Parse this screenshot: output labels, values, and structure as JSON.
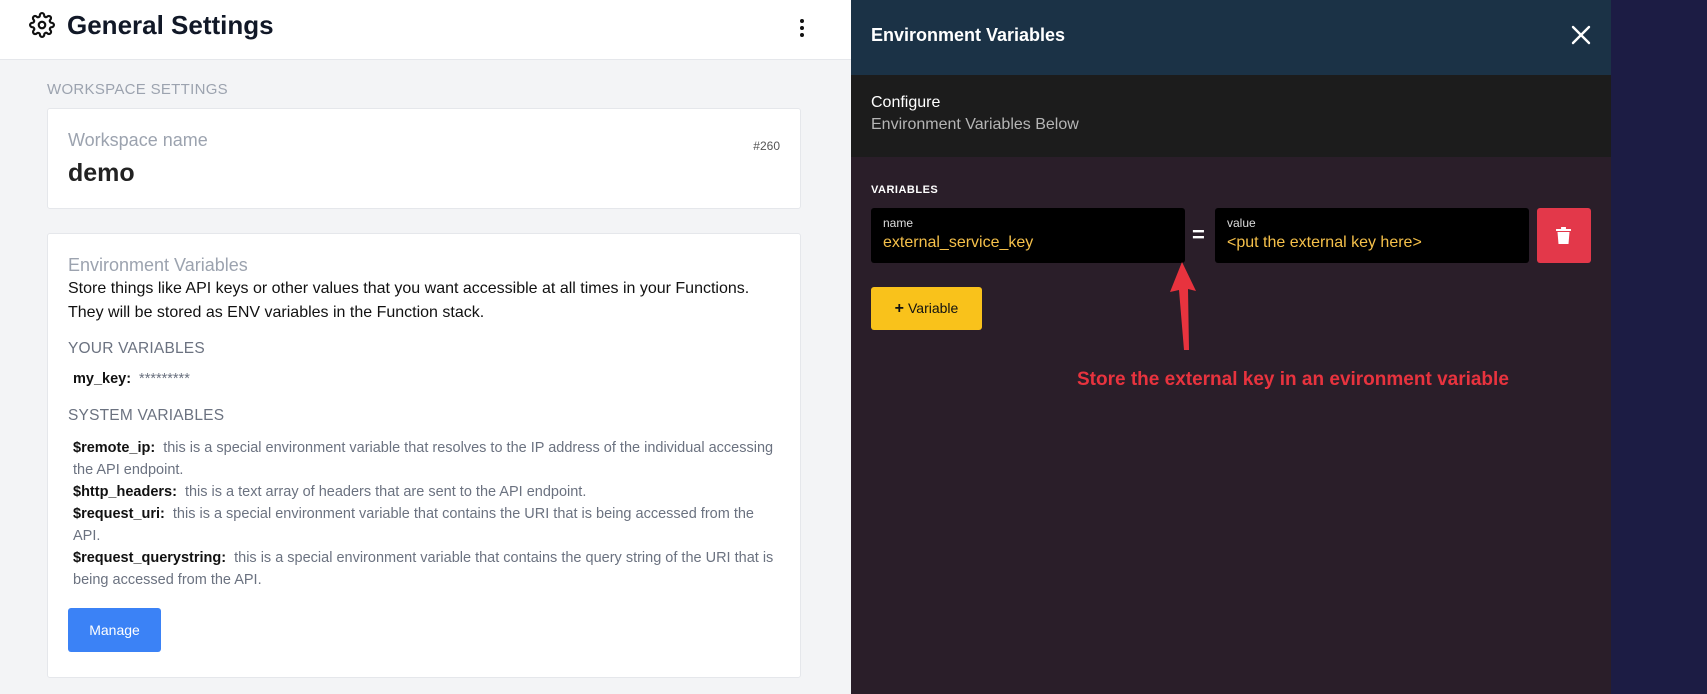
{
  "header": {
    "title": "General Settings"
  },
  "workspace_section": {
    "title": "WORKSPACE SETTINGS",
    "name_label": "Workspace name",
    "name_value": "demo",
    "id": "#260"
  },
  "env_card": {
    "heading": "Environment Variables",
    "description": "Store things like API keys or other values that you want accessible at all times in your Functions. They will be stored as ENV variables in the Function stack.",
    "your_heading": "YOUR VARIABLES",
    "your_vars": [
      {
        "key": "my_key:",
        "value": "*********"
      }
    ],
    "system_heading": "SYSTEM VARIABLES",
    "system_vars": [
      {
        "key": "$remote_ip:",
        "desc": "this is a special environment variable that resolves to the IP address of the individual accessing the API endpoint."
      },
      {
        "key": "$http_headers:",
        "desc": "this is a text array of headers that are sent to the API endpoint."
      },
      {
        "key": "$request_uri:",
        "desc": "this is a special environment variable that contains the URI that is being accessed from the API."
      },
      {
        "key": "$request_querystring:",
        "desc": "this is a special environment variable that contains the query string of the URI that is being accessed from the API."
      }
    ],
    "manage_label": "Manage"
  },
  "drawer": {
    "title": "Environment Variables",
    "config_title": "Configure",
    "config_subtitle": "Environment Variables Below",
    "variables_label": "VARIABLES",
    "name_label": "name",
    "name_value": "external_service_key",
    "equals": "=",
    "value_label": "value",
    "value_value": "<put the external key here>",
    "add_label": "Variable",
    "add_plus": "+"
  },
  "annotation": {
    "text": "Store the external key in an evironment variable",
    "color": "#e8333e"
  },
  "colors": {
    "primary": "#3b82f6",
    "drawer_header": "#1b3246",
    "drawer_bg": "#2a1e29",
    "add_button": "#f9c21b",
    "delete_button": "#e3384a",
    "input_text": "#f5c04a"
  }
}
